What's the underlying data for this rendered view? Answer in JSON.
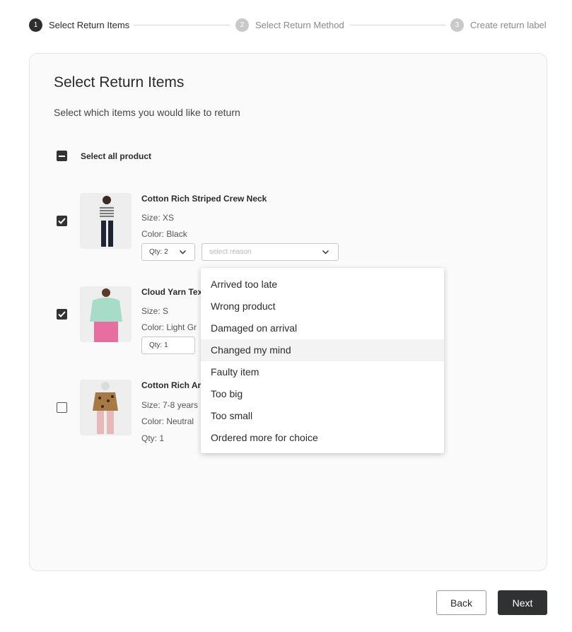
{
  "stepper": {
    "steps": [
      {
        "number": "1",
        "label": "Select Return Items",
        "state": "active"
      },
      {
        "number": "2",
        "label": "Select Return Method",
        "state": "inactive"
      },
      {
        "number": "3",
        "label": "Create return label",
        "state": "inactive"
      }
    ]
  },
  "card": {
    "title": "Select Return Items",
    "subtitle": "Select which items you would like to return"
  },
  "select_all": {
    "label": "Select all product",
    "state": "indeterminate"
  },
  "items": [
    {
      "name": "Cotton Rich Striped Crew Neck",
      "size": "Size: XS",
      "color": "Color: Black",
      "qty": "Qty: 2",
      "checked": true,
      "reason_placeholder": "select reason"
    },
    {
      "name": "Cloud Yarn Tex",
      "size": "Size: S",
      "color": "Color: Light Gr",
      "qty": "Qty: 1",
      "checked": true
    },
    {
      "name": "Cotton Rich Ar",
      "size": "Size: 7-8 years",
      "color": "Color: Neutral",
      "qty": "Qty: 1",
      "checked": false
    }
  ],
  "reason_dropdown": {
    "options": [
      "Arrived too late",
      "Wrong product",
      "Damaged on arrival",
      "Changed my mind",
      "Faulty item",
      "Too big",
      "Too small",
      "Ordered more for choice"
    ],
    "highlighted": "Changed my mind"
  },
  "buttons": {
    "back": "Back",
    "next": "Next"
  },
  "colors": {
    "primary": "#2f3133",
    "inactive_step": "#c9c9c9",
    "card_bg": "#fafafa"
  }
}
